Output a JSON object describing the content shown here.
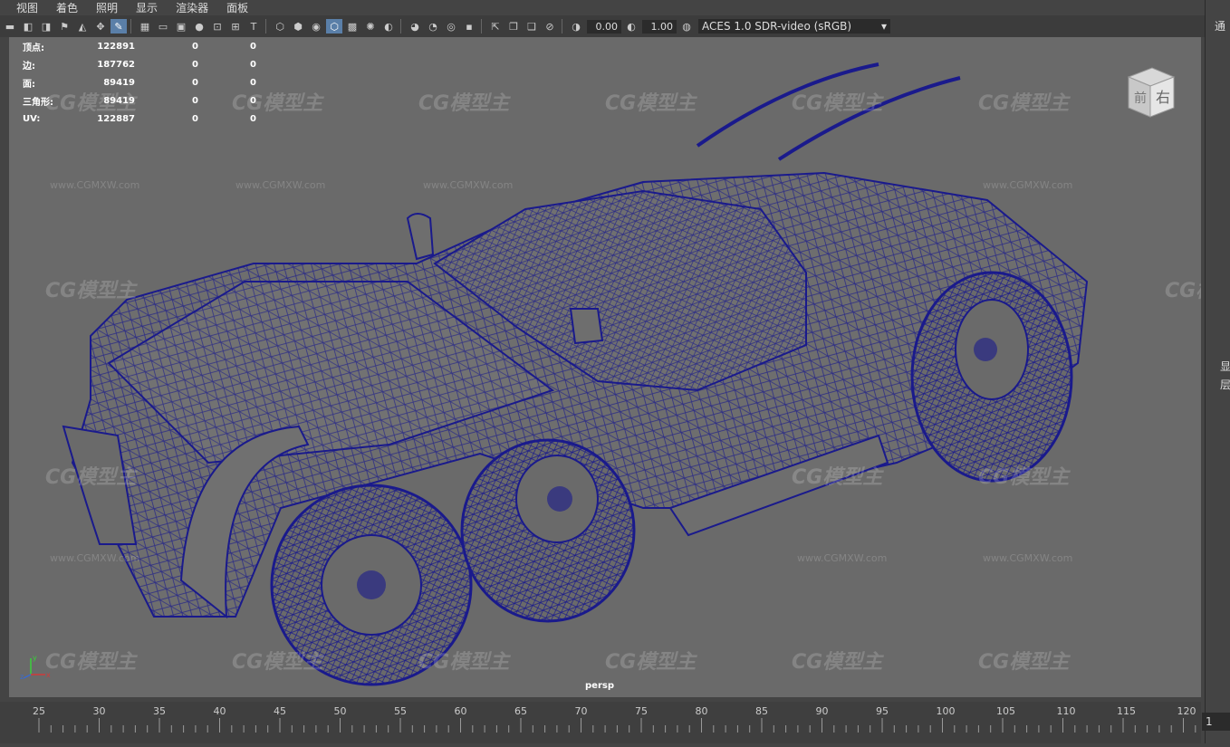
{
  "menu": [
    "视图",
    "着色",
    "照明",
    "显示",
    "渲染器",
    "面板"
  ],
  "toolbar": {
    "exposure": "0.00",
    "gamma": "1.00",
    "color_space": "ACES 1.0 SDR-video (sRGB)"
  },
  "hud": {
    "rows": [
      {
        "label": "顶点:",
        "v1": "122891",
        "v2": "0",
        "v3": "0"
      },
      {
        "label": "边:",
        "v1": "187762",
        "v2": "0",
        "v3": "0"
      },
      {
        "label": "面:",
        "v1": "89419",
        "v2": "0",
        "v3": "0"
      },
      {
        "label": "三角形:",
        "v1": "89419",
        "v2": "0",
        "v3": "0"
      },
      {
        "label": "UV:",
        "v1": "122887",
        "v2": "0",
        "v3": "0"
      }
    ]
  },
  "viewport": {
    "camera_label": "persp",
    "viewcube": {
      "front": "前",
      "right": "右"
    },
    "wireframe_color": "#1a1a8c",
    "background_color": "#6a6a6a"
  },
  "watermark": {
    "logo": "CG模型主",
    "url": "www.CGMXW.com"
  },
  "timeline": {
    "ticks": [
      "25",
      "30",
      "35",
      "40",
      "45",
      "50",
      "55",
      "60",
      "65",
      "70",
      "75",
      "80",
      "85",
      "90",
      "95",
      "100",
      "105",
      "110",
      "115",
      "120"
    ],
    "current_frame": "1"
  },
  "right_panel": {
    "top_label": "通",
    "side_label_1": "显",
    "side_label_2": "层"
  }
}
